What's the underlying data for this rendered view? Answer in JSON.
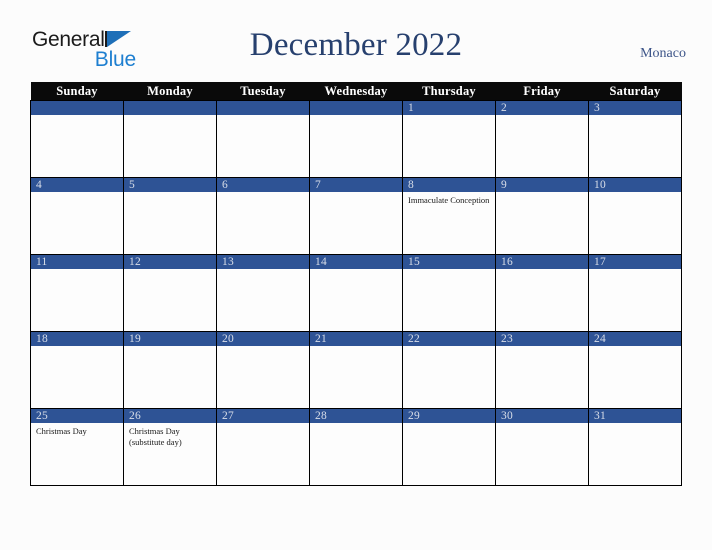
{
  "header": {
    "brand": {
      "word1": "General",
      "word2": "Blue",
      "triangle_icon": "blue-triangle-icon"
    },
    "title": "December 2022",
    "locale": "Monaco"
  },
  "calendar": {
    "weekday_headers": [
      "Sunday",
      "Monday",
      "Tuesday",
      "Wednesday",
      "Thursday",
      "Friday",
      "Saturday"
    ],
    "colors": {
      "date_bar": "#2e5395",
      "header_bar": "#0a0a0a",
      "title": "#27406e",
      "locale": "#3c5488",
      "brand_blue": "#1e7fd0",
      "cell_background": "#fdfdfd",
      "page_background": "#fcfcfc"
    },
    "weeks": [
      [
        {
          "day": "",
          "event": "",
          "empty": true
        },
        {
          "day": "",
          "event": "",
          "empty": true
        },
        {
          "day": "",
          "event": "",
          "empty": true
        },
        {
          "day": "",
          "event": "",
          "empty": true
        },
        {
          "day": "1",
          "event": "",
          "empty": false
        },
        {
          "day": "2",
          "event": "",
          "empty": false
        },
        {
          "day": "3",
          "event": "",
          "empty": false
        }
      ],
      [
        {
          "day": "4",
          "event": "",
          "empty": false
        },
        {
          "day": "5",
          "event": "",
          "empty": false
        },
        {
          "day": "6",
          "event": "",
          "empty": false
        },
        {
          "day": "7",
          "event": "",
          "empty": false
        },
        {
          "day": "8",
          "event": "Immaculate Conception",
          "empty": false
        },
        {
          "day": "9",
          "event": "",
          "empty": false
        },
        {
          "day": "10",
          "event": "",
          "empty": false
        }
      ],
      [
        {
          "day": "11",
          "event": "",
          "empty": false
        },
        {
          "day": "12",
          "event": "",
          "empty": false
        },
        {
          "day": "13",
          "event": "",
          "empty": false
        },
        {
          "day": "14",
          "event": "",
          "empty": false
        },
        {
          "day": "15",
          "event": "",
          "empty": false
        },
        {
          "day": "16",
          "event": "",
          "empty": false
        },
        {
          "day": "17",
          "event": "",
          "empty": false
        }
      ],
      [
        {
          "day": "18",
          "event": "",
          "empty": false
        },
        {
          "day": "19",
          "event": "",
          "empty": false
        },
        {
          "day": "20",
          "event": "",
          "empty": false
        },
        {
          "day": "21",
          "event": "",
          "empty": false
        },
        {
          "day": "22",
          "event": "",
          "empty": false
        },
        {
          "day": "23",
          "event": "",
          "empty": false
        },
        {
          "day": "24",
          "event": "",
          "empty": false
        }
      ],
      [
        {
          "day": "25",
          "event": "Christmas Day",
          "empty": false
        },
        {
          "day": "26",
          "event": "Christmas Day (substitute day)",
          "empty": false
        },
        {
          "day": "27",
          "event": "",
          "empty": false
        },
        {
          "day": "28",
          "event": "",
          "empty": false
        },
        {
          "day": "29",
          "event": "",
          "empty": false
        },
        {
          "day": "30",
          "event": "",
          "empty": false
        },
        {
          "day": "31",
          "event": "",
          "empty": false
        }
      ]
    ]
  }
}
